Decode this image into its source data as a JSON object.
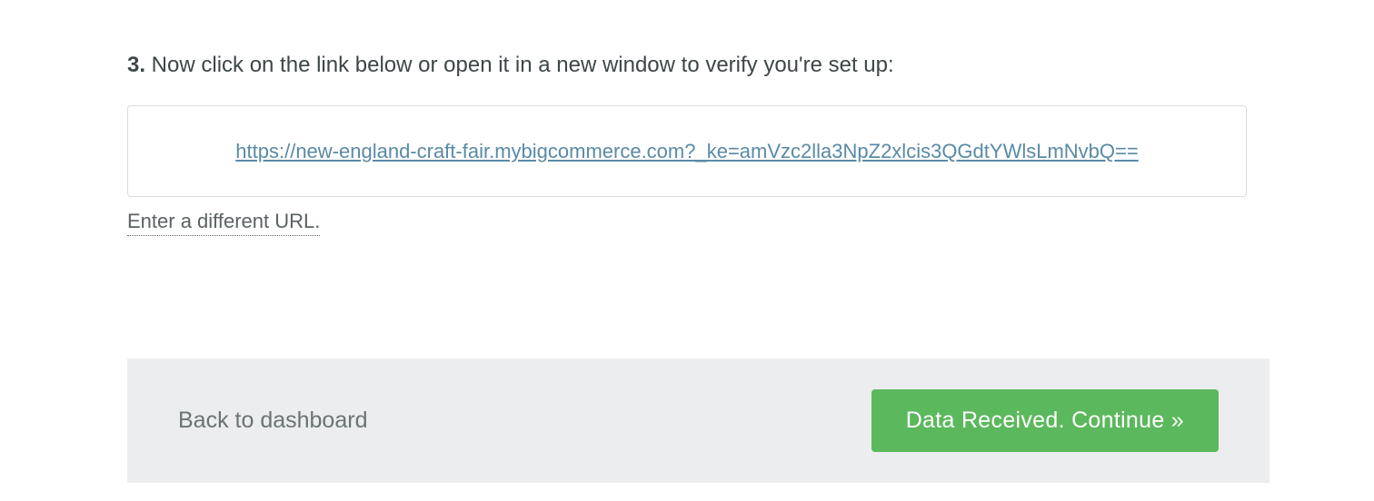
{
  "step": {
    "number": "3.",
    "text": " Now click on the link below or open it in a new window to verify you're set up:"
  },
  "url_box": {
    "url": "https://new-england-craft-fair.mybigcommerce.com?_ke=amVzc2lla3NpZ2xlcis3QGdtYWlsLmNvbQ=="
  },
  "enter_different_label": "Enter a different URL.",
  "footer": {
    "back_label": "Back to dashboard",
    "continue_label": "Data Received. Continue »"
  }
}
